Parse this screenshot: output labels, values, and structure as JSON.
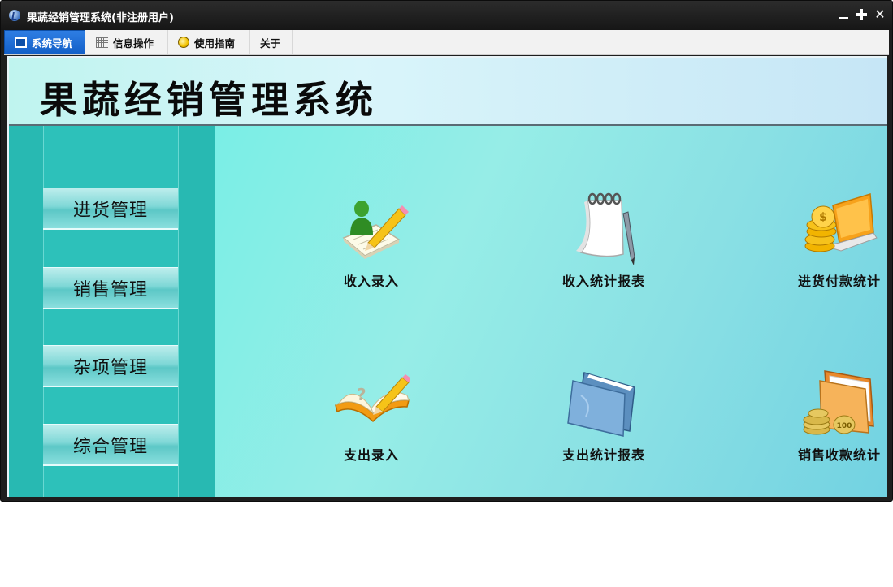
{
  "window": {
    "title": "果蔬经销管理系统(非注册用户)",
    "minimize_symbol": "",
    "close_symbol": "✕"
  },
  "menu": {
    "tabs": [
      {
        "label": "系统导航",
        "icon": "monitor-icon",
        "active": true
      },
      {
        "label": "信息操作",
        "icon": "grid-icon",
        "active": false
      },
      {
        "label": "使用指南",
        "icon": "lightbulb-icon",
        "active": false
      },
      {
        "label": "关于",
        "icon": "",
        "active": false
      }
    ]
  },
  "banner": {
    "title": "果蔬经销管理系统"
  },
  "sidebar": {
    "items": [
      {
        "label": "进货管理"
      },
      {
        "label": "销售管理"
      },
      {
        "label": "杂项管理"
      },
      {
        "label": "综合管理"
      }
    ]
  },
  "tiles": [
    {
      "label": "收入录入",
      "icon": "person-pencil-notepad-icon"
    },
    {
      "label": "收入统计报表",
      "icon": "spiral-notepad-pen-icon"
    },
    {
      "label": "进货付款统计",
      "icon": "coins-laptop-icon"
    },
    {
      "label": "支出录入",
      "icon": "open-book-pencil-icon"
    },
    {
      "label": "支出统计报表",
      "icon": "blue-folder-icon"
    },
    {
      "label": "销售收款统计",
      "icon": "folder-coins-icon"
    }
  ],
  "colors": {
    "titlebar": "#1e1e1e",
    "active_tab": "#1f6fd6",
    "sidebar": "#28b9b2",
    "main_area": "#8ae8e4"
  }
}
